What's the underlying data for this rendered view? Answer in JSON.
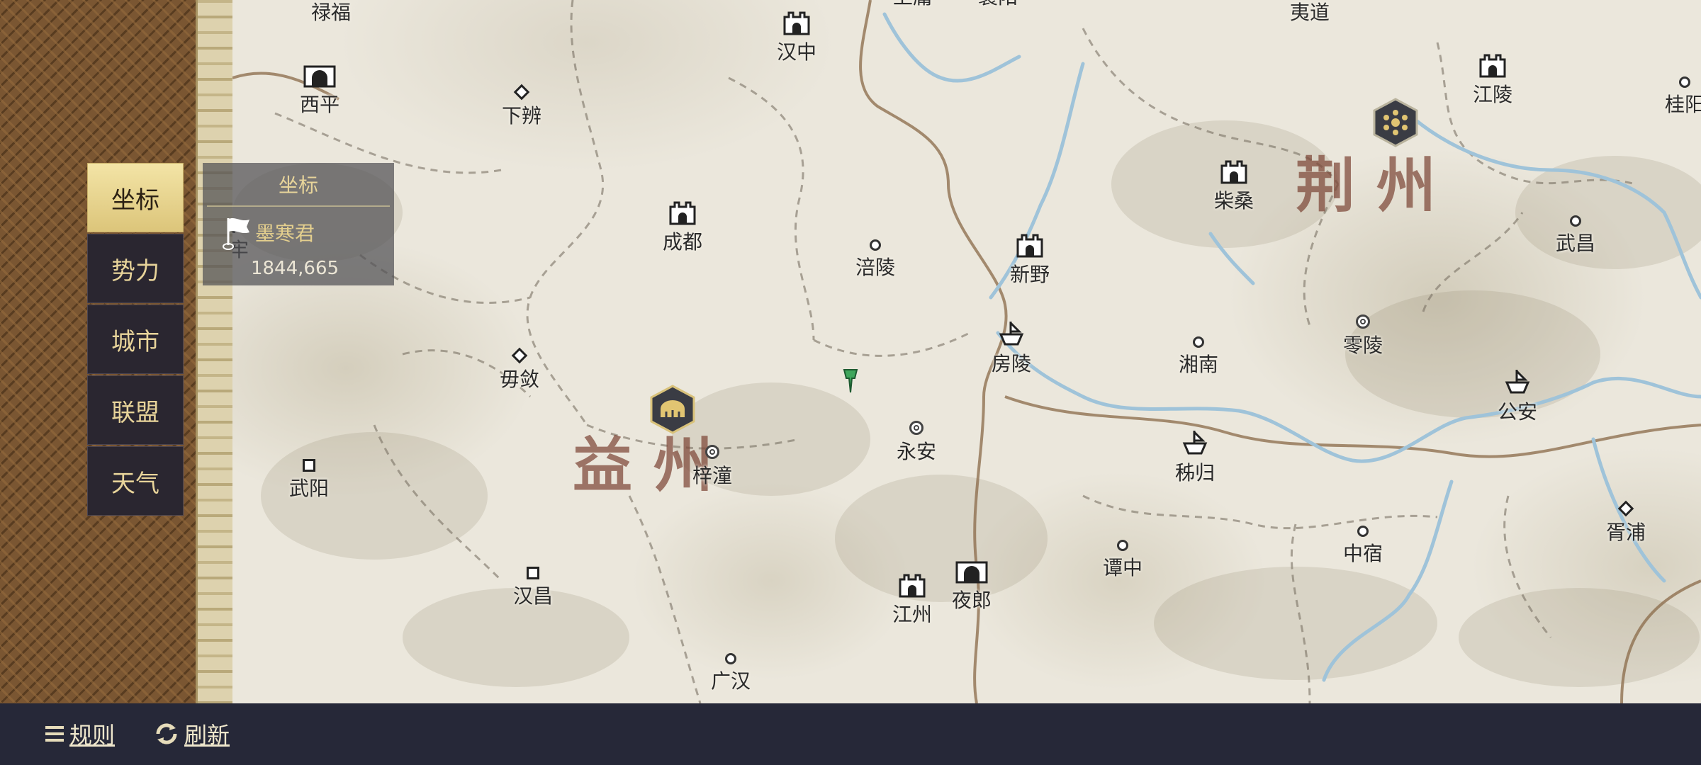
{
  "menu": {
    "items": [
      {
        "label": "坐标",
        "active": true
      },
      {
        "label": "势力",
        "active": false
      },
      {
        "label": "城市",
        "active": false
      },
      {
        "label": "联盟",
        "active": false
      },
      {
        "label": "天气",
        "active": false
      }
    ]
  },
  "coord_panel": {
    "title": "坐标",
    "owner": "墨寒君",
    "coords": "1844,665",
    "icon": "flag-icon"
  },
  "regions": {
    "yi": "益州",
    "jing": "荆州"
  },
  "cities": {
    "lufu": "禄福",
    "xiping": "西平",
    "xiabian": "下辨",
    "hanzhong": "汉中",
    "shangyong": "上庸",
    "xiangyang": "襄阳",
    "yidao": "夷道",
    "jiangling": "江陵",
    "guiyang": "桂阳",
    "chaisang": "柴桑",
    "chengdu": "成都",
    "fuling": "涪陵",
    "xinye": "新野",
    "wuchang": "武昌",
    "aolao": "哀牢",
    "fangling": "房陵",
    "xiangnan": "湘南",
    "lingling": "零陵",
    "mulian": "毋敛",
    "gongan": "公安",
    "yongan": "永安",
    "zitong": "梓潼",
    "zigui": "秭归",
    "wuyang": "武阳",
    "xupu": "胥浦",
    "tanzhong": "谭中",
    "zhongsu": "中宿",
    "jiangzhou": "江州",
    "yelang": "夜郎",
    "hanchang": "汉昌",
    "guanghan": "广汉"
  },
  "bottom_bar": {
    "rules_label": "规则",
    "refresh_label": "刷新",
    "rules_icon": "menu-icon",
    "refresh_icon": "refresh-icon"
  },
  "colors": {
    "menu_active": "#e8d58e",
    "menu_inactive": "#2a2630",
    "menu_text": "#e8d49a",
    "river": "#9fc3d9",
    "region_text": "#7d4637",
    "bottom_bar": "#262838"
  }
}
